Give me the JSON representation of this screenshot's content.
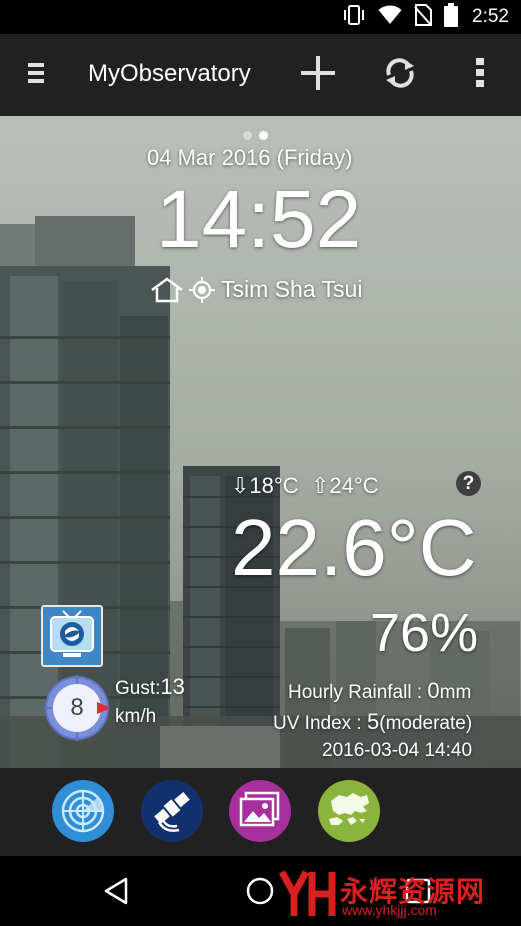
{
  "status_bar": {
    "time": "2:52",
    "icons": [
      "vibrate-icon",
      "wifi-icon",
      "no-sim-icon",
      "battery-icon"
    ]
  },
  "action_bar": {
    "title": "MyObservatory",
    "icons": [
      "menu-icon",
      "add-icon",
      "refresh-icon",
      "overflow-menu-icon"
    ]
  },
  "weather": {
    "date": "04 Mar 2016 (Friday)",
    "time": "14:52",
    "location": "Tsim Sha Tsui",
    "temp_min": "⇩18°C",
    "temp_max": "⇧24°C",
    "temperature": "22.6°C",
    "humidity": "76%",
    "rainfall_label": "Hourly Rainfall : ",
    "rainfall_value": "0",
    "rainfall_unit": "mm",
    "uv_label": "UV Index : ",
    "uv_value": "5",
    "uv_level": "(moderate)",
    "updated": "2016-03-04 14:40",
    "wind_force": "8",
    "gust_label": "Gust:",
    "gust_value": "13",
    "gust_unit": "km/h",
    "help_symbol": "?",
    "page_count": 2,
    "active_page": 2
  },
  "tray": {
    "buttons": [
      {
        "name": "radar-button",
        "color": "#2e8fd6"
      },
      {
        "name": "satellite-button",
        "color": "#13306e"
      },
      {
        "name": "gallery-button",
        "color": "#a8309e"
      },
      {
        "name": "map-button",
        "color": "#8ab43c"
      }
    ]
  },
  "nav_bar": {
    "icons": [
      "back-icon",
      "home-icon",
      "recents-icon"
    ]
  },
  "watermark": {
    "text": "永辉资源网",
    "url": "www.yhkjjj.com"
  }
}
